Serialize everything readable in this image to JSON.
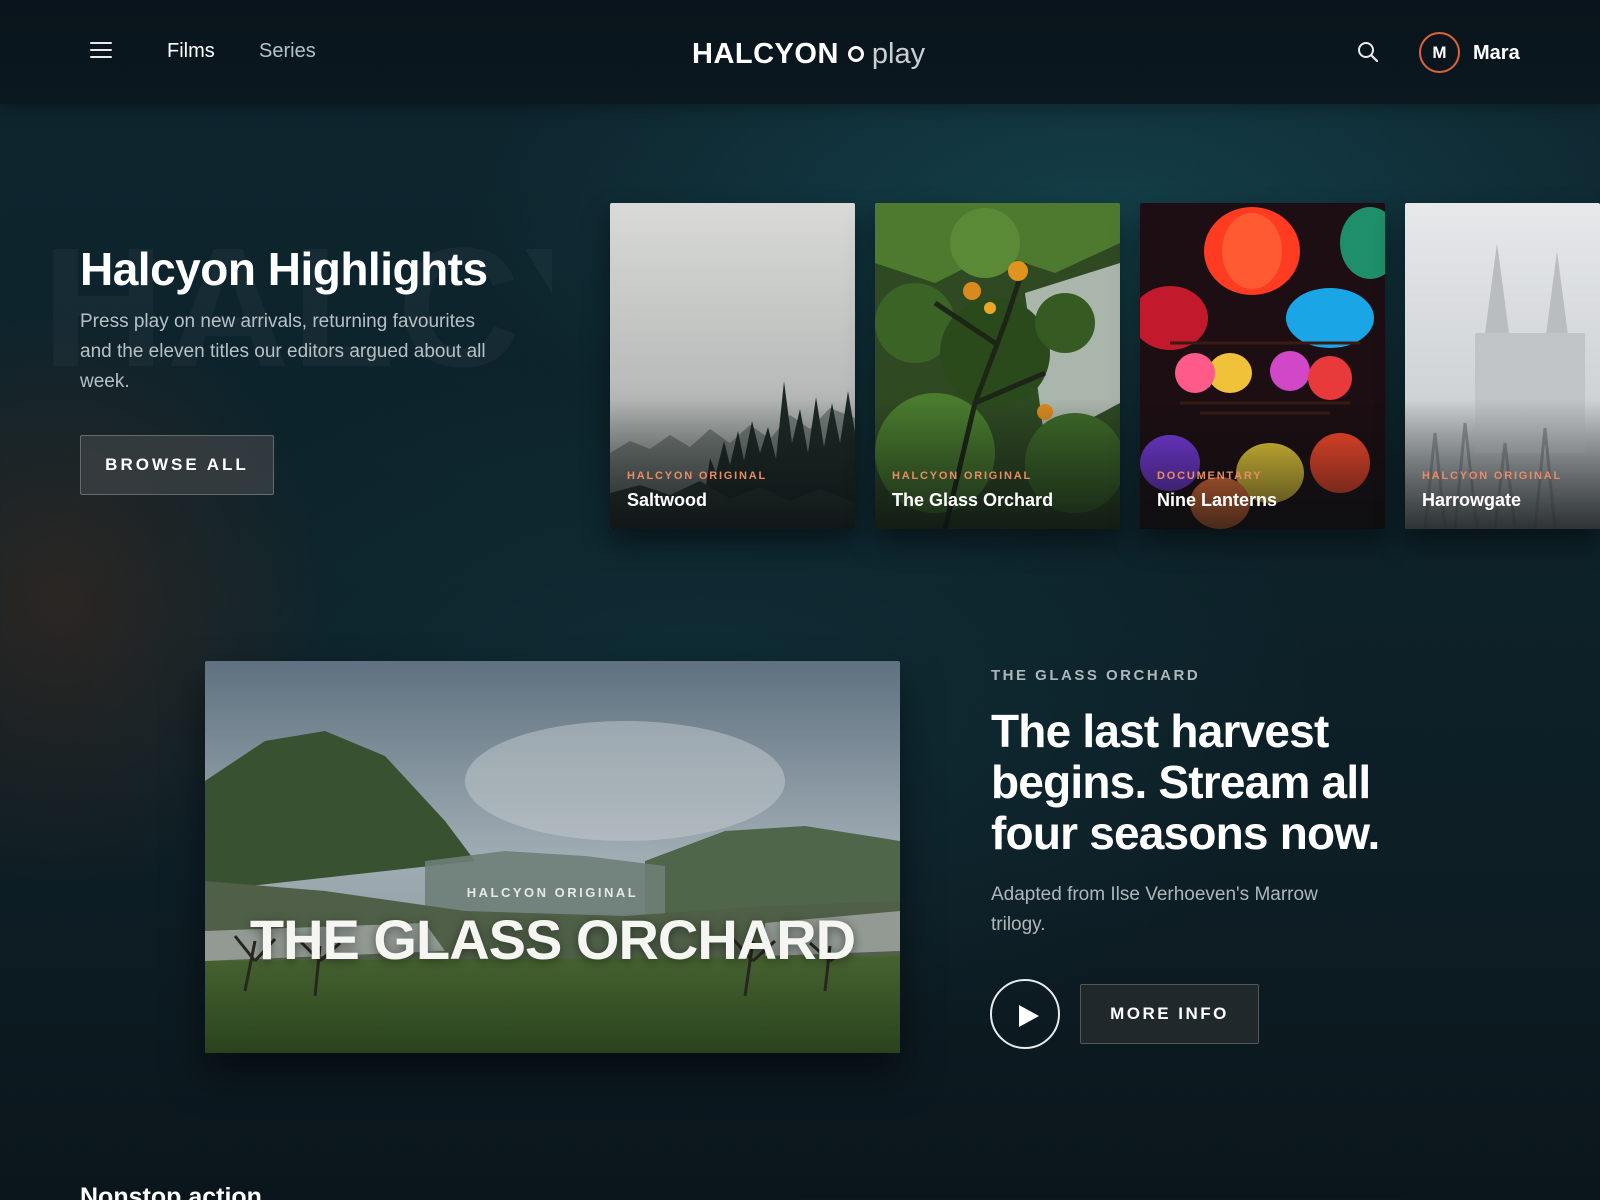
{
  "header": {
    "nav": [
      "Films",
      "Series"
    ],
    "logo": {
      "word": "HALCYON",
      "suffix": "play"
    },
    "user": {
      "initial": "M",
      "name": "Mara"
    },
    "accent_color": "#e0623c"
  },
  "highlights": {
    "title": "Halcyon Highlights",
    "description": "Press play on new arrivals, returning favourites and the eleven titles our editors argued about all week.",
    "browse_label": "BROWSE ALL",
    "cards": [
      {
        "tag": "HALCYON ORIGINAL",
        "title": "Saltwood"
      },
      {
        "tag": "HALCYON ORIGINAL",
        "title": "The Glass Orchard"
      },
      {
        "tag": "DOCUMENTARY",
        "title": "Nine Lanterns"
      },
      {
        "tag": "HALCYON ORIGINAL",
        "title": "Harrowgate"
      }
    ]
  },
  "feature": {
    "overlay_tag": "HALCYON ORIGINAL",
    "overlay_title": "THE GLASS ORCHARD",
    "kicker": "THE GLASS ORCHARD",
    "headline": "The last harvest begins. Stream all four seasons now.",
    "description": "Adapted from Ilse Verhoeven's Marrow trilogy.",
    "more_label": "MORE INFO"
  },
  "next_section": {
    "title": "Nonstop action"
  }
}
